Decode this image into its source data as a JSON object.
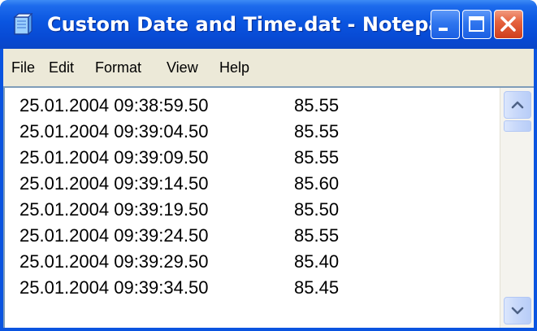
{
  "window": {
    "title": "Custom Date and Time.dat - Notepad",
    "icon": "notepad-icon",
    "controls": [
      {
        "name": "minimize-button",
        "icon": "minimize-icon"
      },
      {
        "name": "maximize-button",
        "icon": "maximize-icon"
      },
      {
        "name": "close-button",
        "icon": "close-icon"
      }
    ]
  },
  "menu": {
    "items": [
      "File",
      "Edit",
      "Format",
      "View",
      "Help"
    ]
  },
  "editor": {
    "lines": [
      {
        "timestamp": "25.01.2004 09:38:59.50",
        "value": "85.55"
      },
      {
        "timestamp": "25.01.2004 09:39:04.50",
        "value": "85.55"
      },
      {
        "timestamp": "25.01.2004 09:39:09.50",
        "value": "85.55"
      },
      {
        "timestamp": "25.01.2004 09:39:14.50",
        "value": "85.60"
      },
      {
        "timestamp": "25.01.2004 09:39:19.50",
        "value": "85.50"
      },
      {
        "timestamp": "25.01.2004 09:39:24.50",
        "value": "85.55"
      },
      {
        "timestamp": "25.01.2004 09:39:29.50",
        "value": "85.40"
      },
      {
        "timestamp": "25.01.2004 09:39:34.50",
        "value": "85.45"
      }
    ]
  },
  "colors": {
    "titlebar": "#0a55e0",
    "close_button": "#e5633f",
    "menubar": "#ece9d8",
    "scrollbar_button": "#c6d7fa"
  }
}
